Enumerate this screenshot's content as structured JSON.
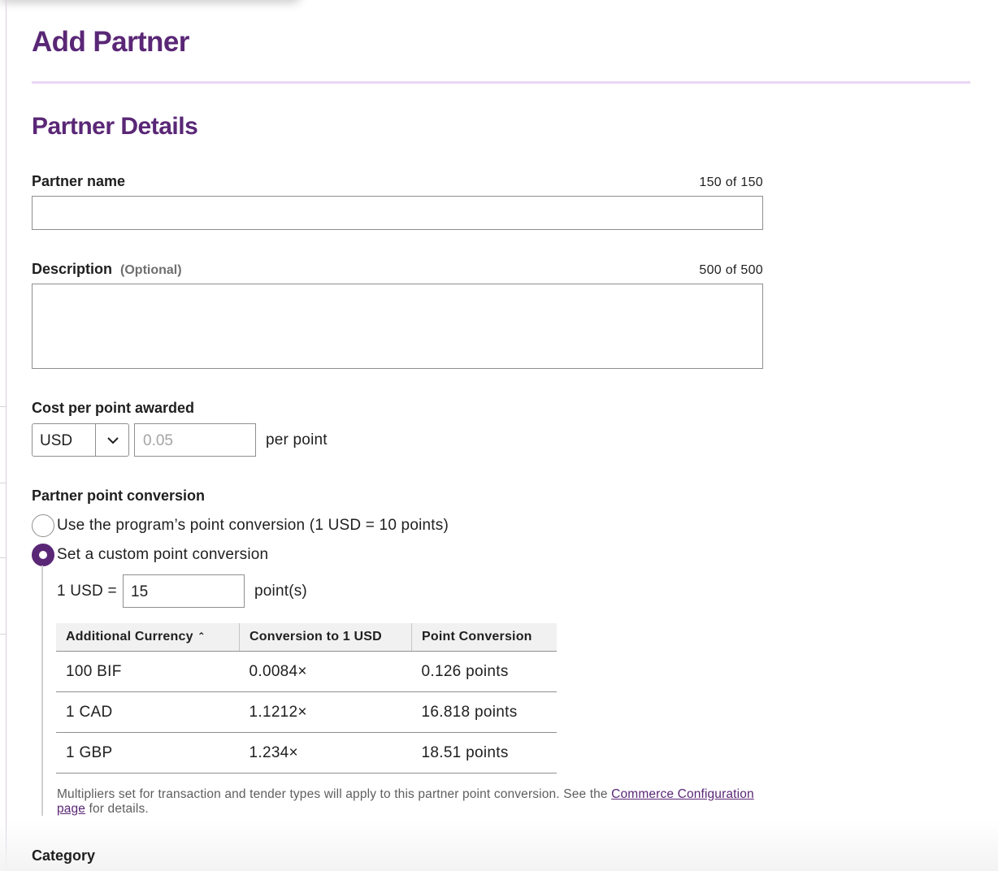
{
  "page": {
    "title": "Add Partner"
  },
  "section": {
    "title": "Partner Details"
  },
  "partner_name": {
    "label": "Partner name",
    "counter": "150 of 150",
    "value": ""
  },
  "description": {
    "label": "Description",
    "optional": "(Optional)",
    "counter": "500 of 500",
    "value": ""
  },
  "cost": {
    "label": "Cost per point awarded",
    "currency": "USD",
    "amount_placeholder": "0.05",
    "suffix": "per point"
  },
  "conversion": {
    "label": "Partner point conversion",
    "option_program": "Use the program’s point conversion (1 USD = 10 points)",
    "option_custom": "Set a custom point conversion",
    "selected": "custom",
    "prefix": "1 USD =",
    "value": "15",
    "suffix": "point(s)"
  },
  "table": {
    "headers": [
      "Additional Currency",
      "Conversion to 1 USD",
      "Point Conversion"
    ],
    "rows": [
      [
        "100 BIF",
        "0.0084×",
        "0.126 points"
      ],
      [
        "1 CAD",
        "1.1212×",
        "16.818 points"
      ],
      [
        "1 GBP",
        "1.234×",
        "18.51 points"
      ]
    ]
  },
  "note": {
    "text": "Multipliers set for transaction and tender types will apply to this partner point conversion. See the ",
    "link": "Commerce Configuration page",
    "after": " for details."
  },
  "category": {
    "label": "Category"
  },
  "colors": {
    "brand": "#5a2776",
    "rule": "#ead6f3"
  },
  "icons": {
    "select": "chevron-down-icon",
    "sort": "sort-ascending-icon"
  }
}
